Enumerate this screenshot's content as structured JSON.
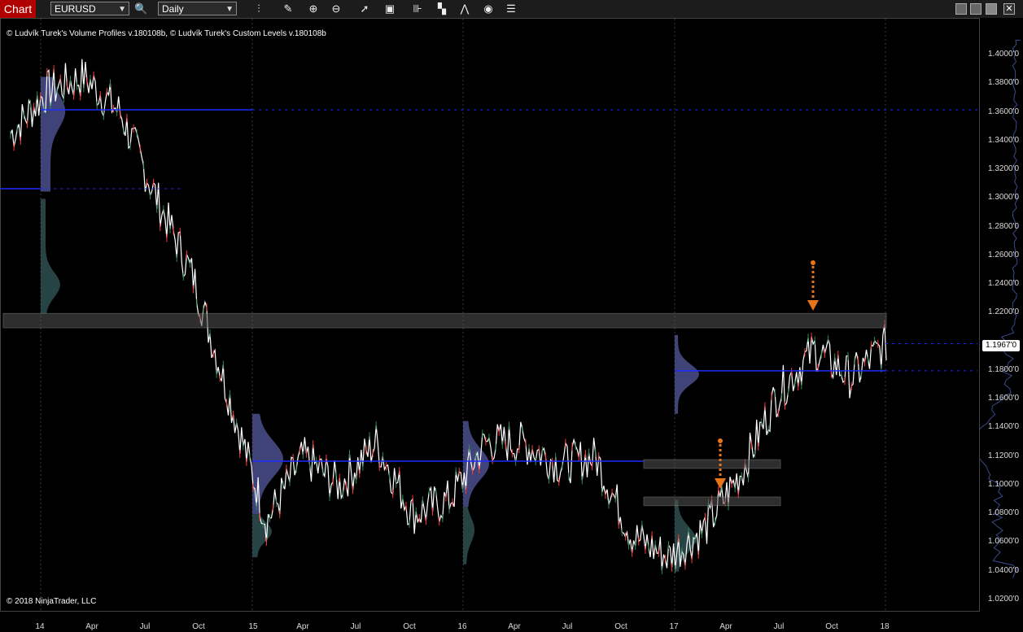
{
  "toolbar": {
    "chart_tab": "Chart",
    "instrument": "EURUSD",
    "interval": "Daily",
    "icons": [
      "search-icon",
      "bars-icon",
      "pencil-icon",
      "zoom-in-icon",
      "zoom-out-icon",
      "pointer-icon",
      "data-box-icon",
      "bar-spacing-icon",
      "series-icon",
      "strategy-icon",
      "refresh-icon",
      "properties-icon"
    ]
  },
  "chart": {
    "indicators_label": "© Ludvík Turek's Volume Profiles v.180108b, © Ludvík Turek's Custom Levels v.180108b",
    "copyright": "© 2018 NinjaTrader, LLC",
    "current_price": "1.1967'0"
  },
  "price_axis": [
    "1.4000'0",
    "1.3800'0",
    "1.3600'0",
    "1.3400'0",
    "1.3200'0",
    "1.3000'0",
    "1.2800'0",
    "1.2600'0",
    "1.2400'0",
    "1.2200'0",
    "1.1800'0",
    "1.1600'0",
    "1.1400'0",
    "1.1200'0",
    "1.1000'0",
    "1.0800'0",
    "1.0600'0",
    "1.0400'0",
    "1.0200'0"
  ],
  "time_axis": [
    "14",
    "Apr",
    "Jul",
    "Oct",
    "15",
    "Apr",
    "Jul",
    "Oct",
    "16",
    "Apr",
    "Jul",
    "Oct",
    "17",
    "Apr",
    "Jul",
    "Oct",
    "18"
  ],
  "chart_data": {
    "type": "line",
    "symbol": "EURUSD",
    "interval": "Daily",
    "x": [
      "2014-01",
      "2014-03",
      "2014-05",
      "2014-07",
      "2014-09",
      "2014-11",
      "2015-01",
      "2015-03",
      "2015-05",
      "2015-07",
      "2015-09",
      "2015-11",
      "2016-01",
      "2016-03",
      "2016-05",
      "2016-07",
      "2016-09",
      "2016-11",
      "2017-01",
      "2017-03",
      "2017-05",
      "2017-07",
      "2017-09",
      "2017-11",
      "2018-01"
    ],
    "series": [
      {
        "values": [
          1.345,
          1.375,
          1.385,
          1.36,
          1.3,
          1.245,
          1.16,
          1.075,
          1.12,
          1.1,
          1.13,
          1.08,
          1.09,
          1.13,
          1.13,
          1.115,
          1.12,
          1.065,
          1.05,
          1.07,
          1.11,
          1.165,
          1.195,
          1.175,
          1.2
        ]
      }
    ],
    "levels": [
      1.362,
      1.307,
      1.117,
      1.18,
      1.213
    ],
    "zones": [
      [
        1.21,
        1.22
      ],
      [
        1.112,
        1.118
      ],
      [
        1.086,
        1.092
      ]
    ],
    "ylim": [
      1.01,
      1.415
    ],
    "colors": {
      "up": "#2e8b57",
      "down": "#ff3b3b",
      "level": "#1e2bff",
      "profile": "#4a4f8c",
      "profile_low": "#2f4f4f",
      "arrow": "#e8741a"
    }
  }
}
